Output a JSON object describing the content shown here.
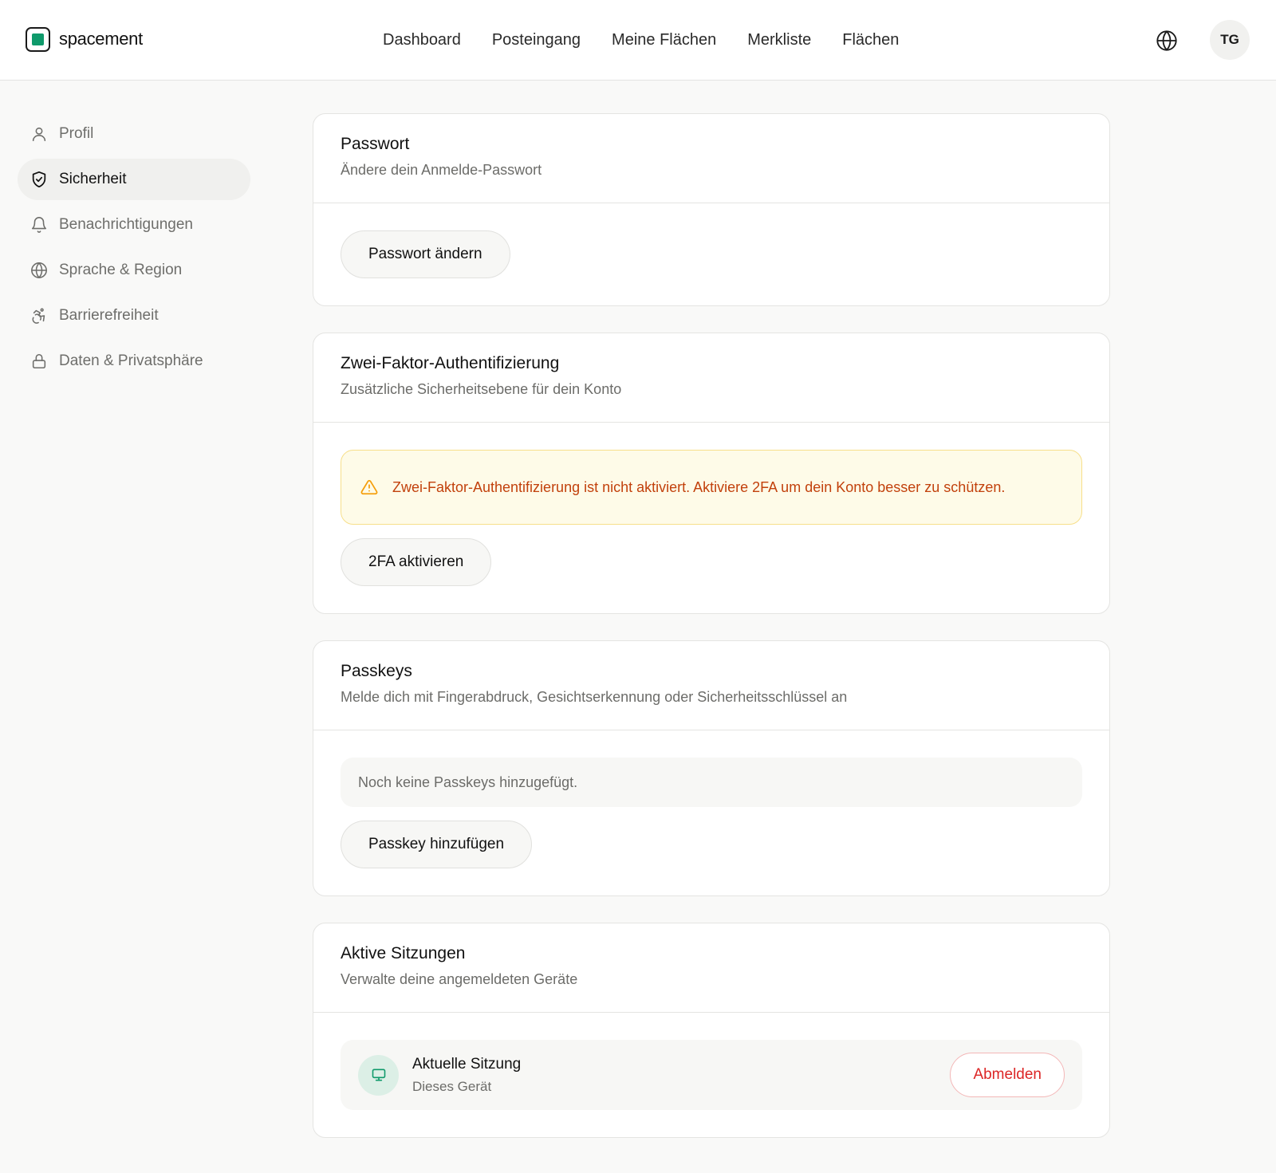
{
  "header": {
    "brand": "spacement",
    "nav": [
      {
        "label": "Dashboard"
      },
      {
        "label": "Posteingang"
      },
      {
        "label": "Meine Flächen"
      },
      {
        "label": "Merkliste"
      },
      {
        "label": "Flächen"
      }
    ],
    "language_icon": "globe-icon",
    "avatar_initials": "TG"
  },
  "sidebar": {
    "items": [
      {
        "label": "Profil",
        "icon": "user-icon",
        "active": false
      },
      {
        "label": "Sicherheit",
        "icon": "shield-icon",
        "active": true
      },
      {
        "label": "Benachrichtigungen",
        "icon": "bell-icon",
        "active": false
      },
      {
        "label": "Sprache & Region",
        "icon": "globe-icon",
        "active": false
      },
      {
        "label": "Barrierefreiheit",
        "icon": "accessibility-icon",
        "active": false
      },
      {
        "label": "Daten & Privatsphäre",
        "icon": "lock-icon",
        "active": false
      }
    ]
  },
  "password": {
    "title": "Passwort",
    "subtitle": "Ändere dein Anmelde-Passwort",
    "button": "Passwort ändern"
  },
  "twofa": {
    "title": "Zwei-Faktor-Authentifizierung",
    "subtitle": "Zusätzliche Sicherheitsebene für dein Konto",
    "warning": "Zwei-Faktor-Authentifizierung ist nicht aktiviert. Aktiviere 2FA um dein Konto besser zu schützen.",
    "button": "2FA aktivieren"
  },
  "passkeys": {
    "title": "Passkeys",
    "subtitle": "Melde dich mit Fingerabdruck, Gesichtserkennung oder Sicherheitsschlüssel an",
    "empty": "Noch keine Passkeys hinzugefügt.",
    "button": "Passkey hinzufügen"
  },
  "sessions": {
    "title": "Aktive Sitzungen",
    "subtitle": "Verwalte deine angemeldeten Geräte",
    "current": {
      "title": "Aktuelle Sitzung",
      "device": "Dieses Gerät",
      "logout": "Abmelden"
    }
  },
  "colors": {
    "brand": "#0f9a6b",
    "warning_text": "#c2410c",
    "danger": "#dc2626"
  }
}
